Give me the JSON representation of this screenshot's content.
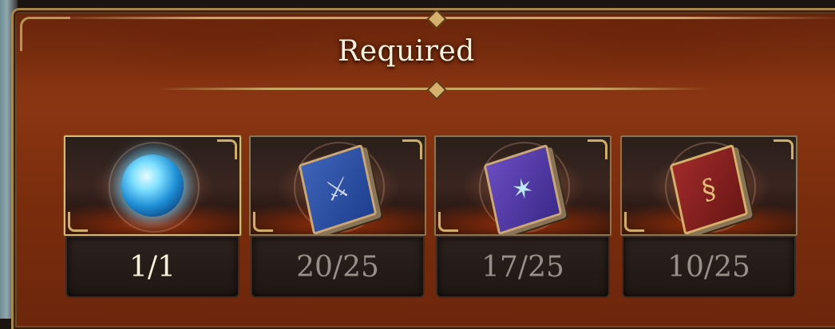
{
  "title": "Required",
  "items": [
    {
      "icon": "crystal-orb-icon",
      "count": "1/1",
      "active": true
    },
    {
      "icon": "sword-tome-icon",
      "count": "20/25",
      "active": false
    },
    {
      "icon": "star-tome-icon",
      "count": "17/25",
      "active": false
    },
    {
      "icon": "rune-tome-icon",
      "count": "10/25",
      "active": false
    }
  ],
  "colors": {
    "panel": "#8a3512",
    "gold": "#c9a467",
    "count_active": "#fbf2de",
    "count_inactive": "#9a8f88"
  }
}
